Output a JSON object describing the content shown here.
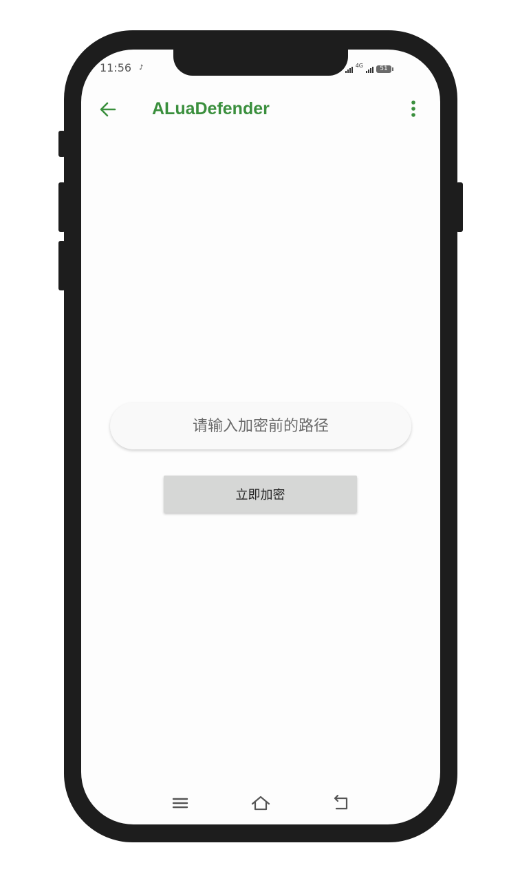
{
  "status_bar": {
    "time": "11:56",
    "network": "4G",
    "battery": "51"
  },
  "app_bar": {
    "title": "ALuaDefender",
    "back_icon": "arrow-left-icon",
    "menu_icon": "more-vert-icon",
    "accent_color": "#3a8f3d"
  },
  "form": {
    "path_placeholder": "请输入加密前的路径",
    "path_value": "",
    "encrypt_label": "立即加密"
  },
  "nav_bar": {
    "icons": [
      "menu-icon",
      "home-icon",
      "back-icon"
    ]
  }
}
